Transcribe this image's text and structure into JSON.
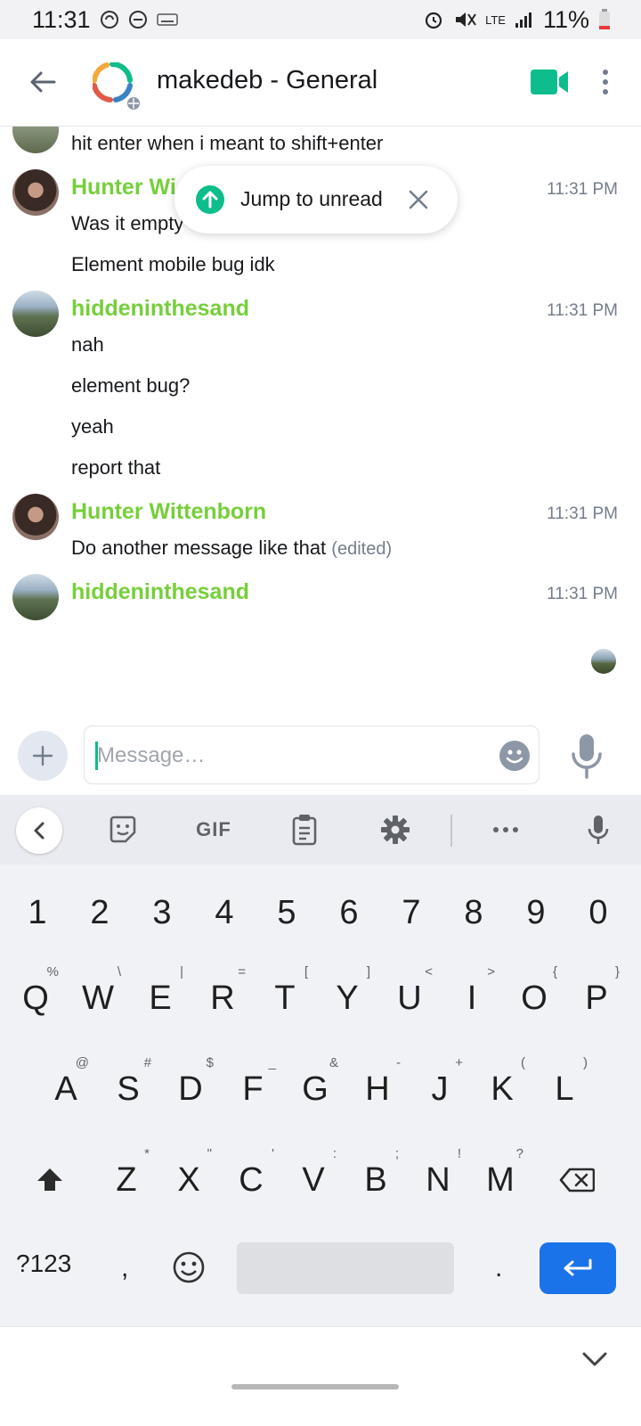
{
  "status_bar": {
    "time": "11:31",
    "battery": "11%",
    "network": "LTE"
  },
  "header": {
    "room_name": "makedeb - General"
  },
  "timeline": {
    "prev_tail": "hit enter when i meant to shift+enter",
    "groups": [
      {
        "sender": "Hunter Wi",
        "time": "11:31 PM",
        "lines": [
          "Was it empty",
          "Element mobile bug idk"
        ]
      },
      {
        "sender": "hiddeninthesand",
        "time": "11:31 PM",
        "lines": [
          "nah",
          "element bug?",
          "yeah",
          "report that"
        ]
      },
      {
        "sender": "Hunter Wittenborn",
        "time": "11:31 PM",
        "lines": [
          "Do another message like that"
        ],
        "edited": "(edited)"
      },
      {
        "sender": "hiddeninthesand",
        "time": "11:31 PM",
        "lines": []
      }
    ]
  },
  "jump_pill": {
    "label": "Jump to unread"
  },
  "composer": {
    "placeholder": "Message…"
  },
  "keyboard": {
    "toolbar": {
      "gif": "GIF"
    },
    "row_numbers": [
      "1",
      "2",
      "3",
      "4",
      "5",
      "6",
      "7",
      "8",
      "9",
      "0"
    ],
    "row1": [
      {
        "k": "Q",
        "h": "%"
      },
      {
        "k": "W",
        "h": "\\"
      },
      {
        "k": "E",
        "h": "|"
      },
      {
        "k": "R",
        "h": "="
      },
      {
        "k": "T",
        "h": "["
      },
      {
        "k": "Y",
        "h": "]"
      },
      {
        "k": "U",
        "h": "<"
      },
      {
        "k": "I",
        "h": ">"
      },
      {
        "k": "O",
        "h": "{"
      },
      {
        "k": "P",
        "h": "}"
      }
    ],
    "row2": [
      {
        "k": "A",
        "h": "@"
      },
      {
        "k": "S",
        "h": "#"
      },
      {
        "k": "D",
        "h": "$"
      },
      {
        "k": "F",
        "h": "_"
      },
      {
        "k": "G",
        "h": "&"
      },
      {
        "k": "H",
        "h": "-"
      },
      {
        "k": "J",
        "h": "+"
      },
      {
        "k": "K",
        "h": "("
      },
      {
        "k": "L",
        "h": ")"
      }
    ],
    "row3": [
      {
        "k": "Z",
        "h": "*"
      },
      {
        "k": "X",
        "h": "\""
      },
      {
        "k": "C",
        "h": "'"
      },
      {
        "k": "V",
        "h": ":"
      },
      {
        "k": "B",
        "h": ";"
      },
      {
        "k": "N",
        "h": "!"
      },
      {
        "k": "M",
        "h": "?"
      }
    ],
    "symbols_label": "?123",
    "comma": ",",
    "period": "."
  },
  "colors": {
    "accent": "#0dbd8b",
    "sender": "#76cf3a",
    "enter": "#1a73e8"
  }
}
